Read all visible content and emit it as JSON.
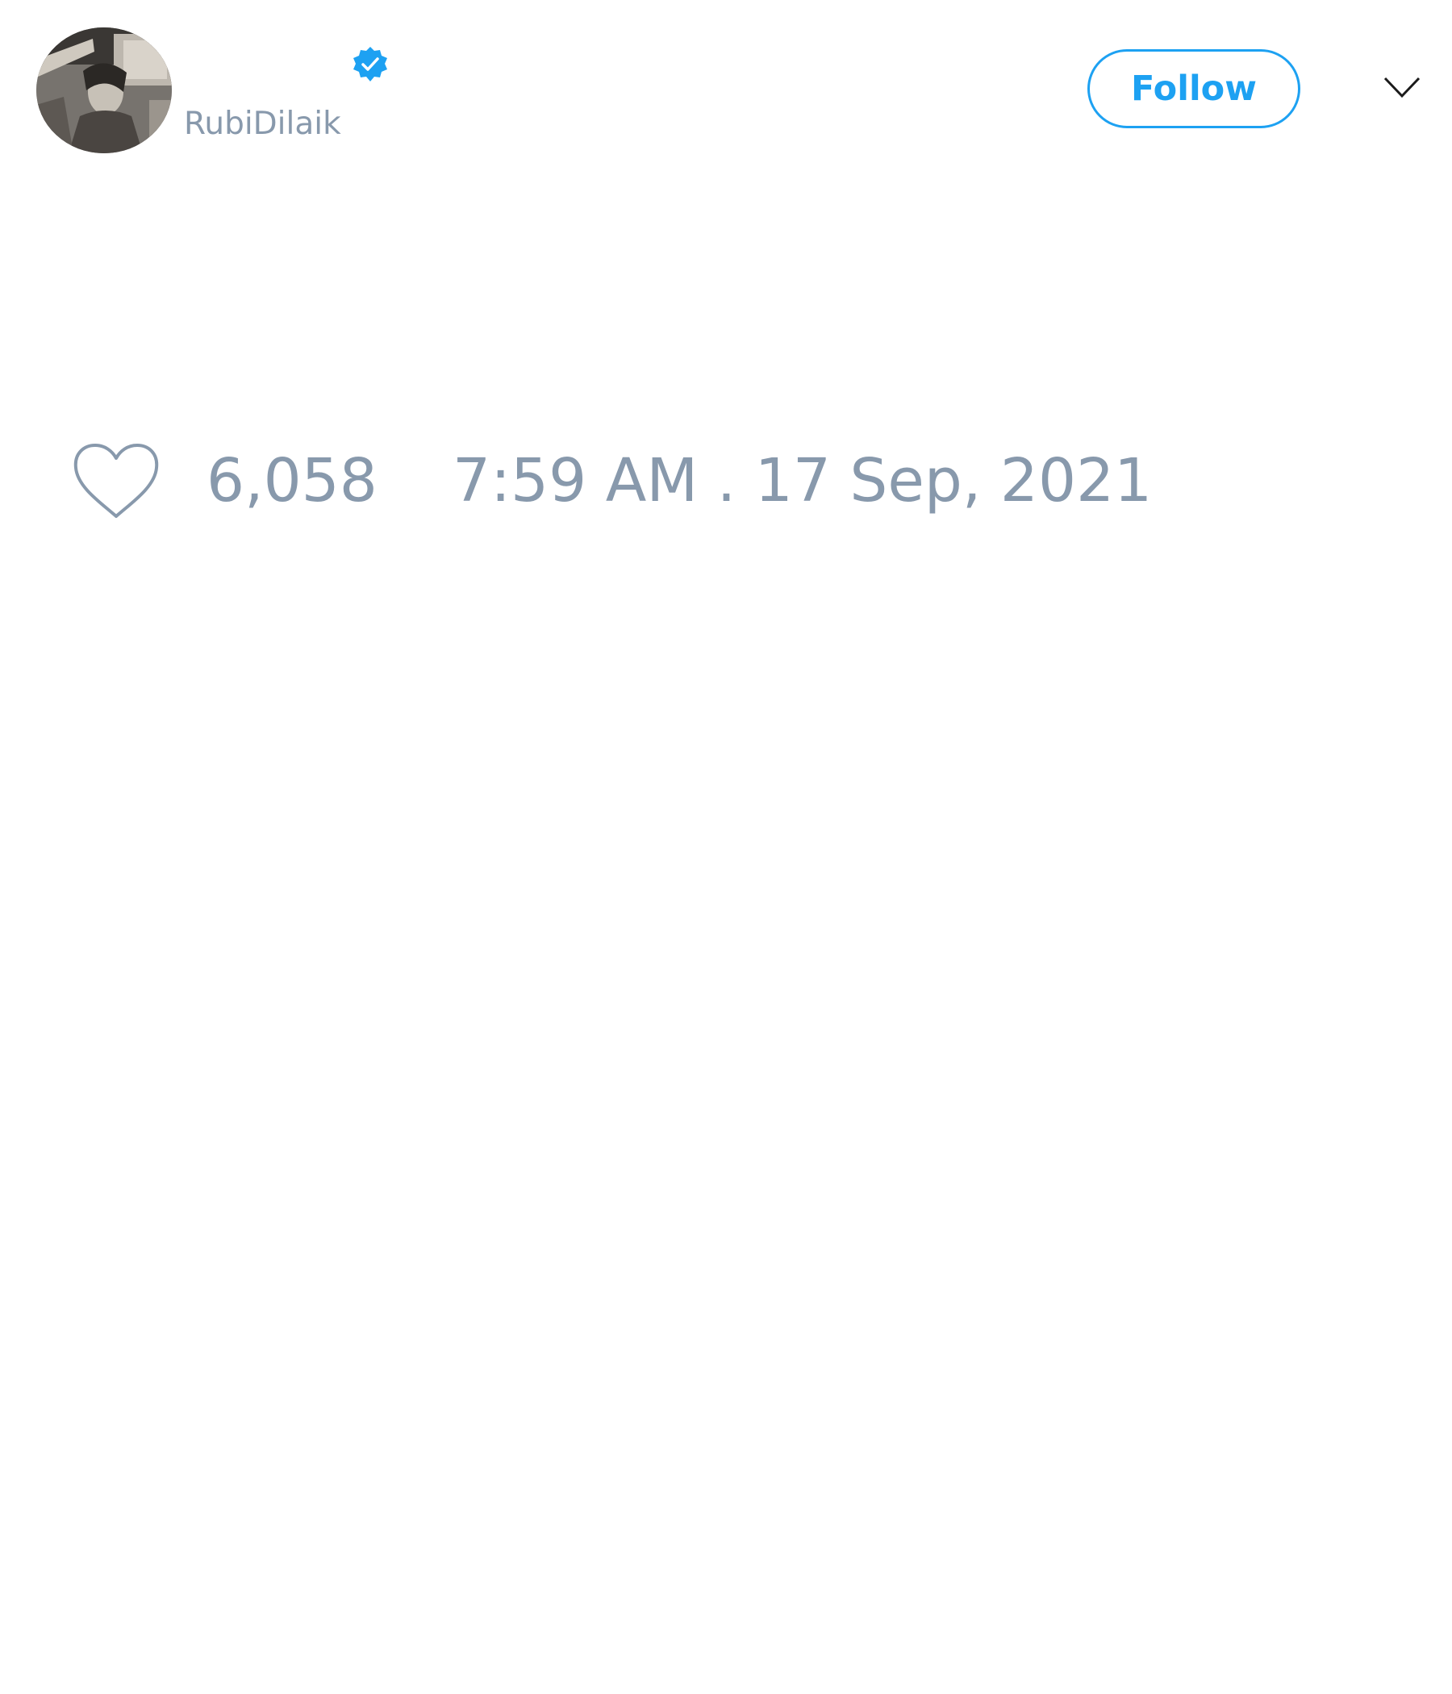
{
  "tweet": {
    "author": {
      "handle": "RubiDilaik",
      "verified": true,
      "avatar_icon": "avatar-photo"
    },
    "follow_label": "Follow",
    "menu_icon": "chevron-down-icon",
    "like_icon": "heart-icon",
    "like_count": "6,058",
    "timestamp": "7:59 AM . 17 Sep, 2021"
  },
  "colors": {
    "accent": "#1da1f2",
    "muted_text": "#8899ac",
    "background": "#ffffff"
  }
}
